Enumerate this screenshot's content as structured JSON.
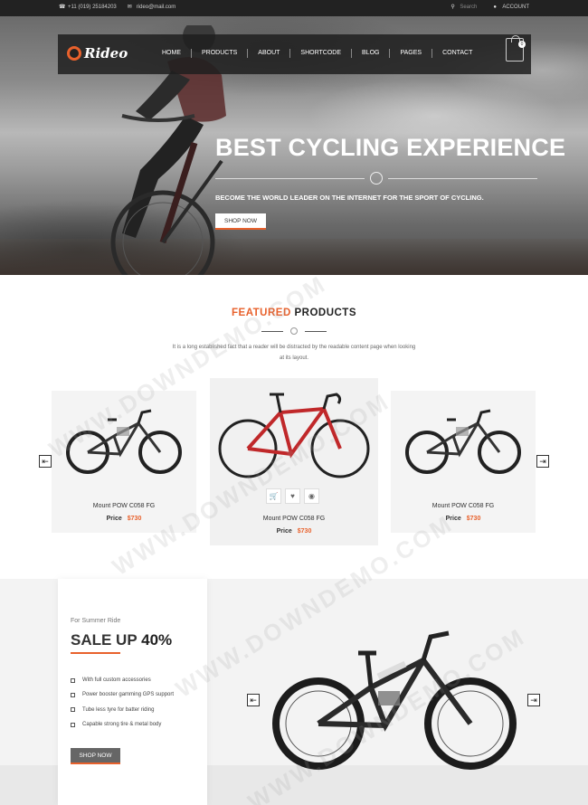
{
  "topbar": {
    "phone": "+11 (019) 25184203",
    "email": "rideo@mail.com",
    "search_label": "Search",
    "account_label": "ACCOUNT"
  },
  "brand": {
    "logo_text": "Rideo",
    "accent": "#e8612c"
  },
  "nav": {
    "items": [
      "HOME",
      "PRODUCTS",
      "ABOUT",
      "SHORTCODE",
      "BLOG",
      "PAGES",
      "CONTACT"
    ],
    "cart_count": "0"
  },
  "hero": {
    "title": "BEST CYCLING EXPERIENCE",
    "subtitle": "BECOME THE WORLD LEADER ON THE INTERNET FOR THE SPORT OF CYCLING.",
    "button": "SHOP NOW"
  },
  "featured": {
    "title_accent": "FEATURED",
    "title_rest": "PRODUCTS",
    "description": "It is a long established fact that a reader will be distracted by the readable content page when looking at its layout.",
    "products": [
      {
        "name": "Mount POW C058 FG",
        "price_label": "Price",
        "price": "$730",
        "color": "#222222"
      },
      {
        "name": "Mount POW C058 FG",
        "price_label": "Price",
        "price": "$730",
        "color": "#c0282a"
      },
      {
        "name": "Mount POW C058 FG",
        "price_label": "Price",
        "price": "$730",
        "color": "#222222"
      }
    ],
    "actions": [
      "cart-icon",
      "heart-icon",
      "eye-icon"
    ]
  },
  "sale": {
    "kicker": "For Summer Ride",
    "head": "SALE UP",
    "percent": "40%",
    "features": [
      "With full custom accessories",
      "Power booster gamming GPS support",
      "Tube less tyre for batter riding",
      "Capable strong tire & metal body"
    ],
    "button": "SHOP NOW"
  },
  "watermark": "WWW.DOWNDEMO.COM"
}
